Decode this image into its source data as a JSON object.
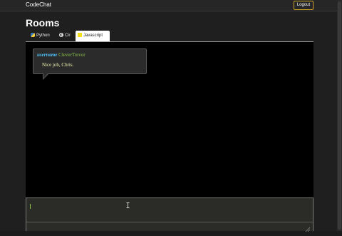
{
  "navbar": {
    "brand": "CodeChat",
    "logout_label": "Logout"
  },
  "page": {
    "title": "Rooms"
  },
  "tabs": [
    {
      "label": "Python",
      "icon": "python-icon",
      "active": false
    },
    {
      "label": "C#",
      "icon": "csharp-icon",
      "active": false
    },
    {
      "label": "Javascript",
      "icon": "javascript-icon",
      "active": true
    }
  ],
  "messages": [
    {
      "user_label": "username",
      "user_name": "CleverTrevor",
      "text": "Nice job, Chris."
    }
  ],
  "input": {
    "value": ""
  },
  "colors": {
    "accent_border": "#c9a227",
    "username_label": "#4fc3f7",
    "username_name": "#8bc34a",
    "message_text": "#f0f0b0"
  }
}
